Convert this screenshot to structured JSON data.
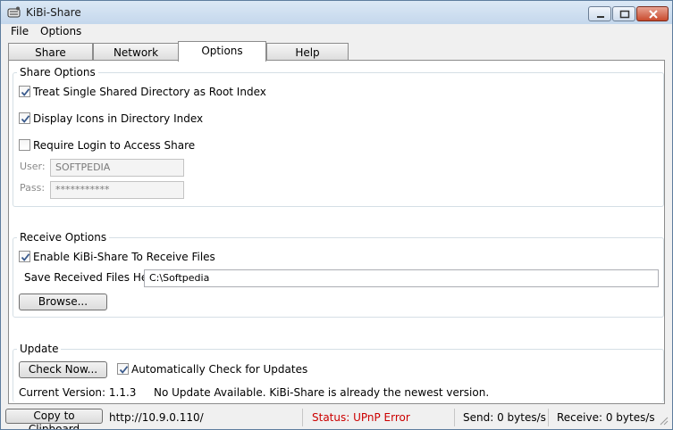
{
  "window": {
    "title": "KiBi-Share"
  },
  "menu": [
    "File",
    "Options"
  ],
  "tabs": [
    {
      "label": "Share"
    },
    {
      "label": "Network"
    },
    {
      "label": "Options"
    },
    {
      "label": "Help"
    }
  ],
  "active_tab": "Options",
  "share_options": {
    "title": "Share Options",
    "treat_root": {
      "label": "Treat Single Shared Directory as Root Index",
      "checked": true
    },
    "display_icons": {
      "label": "Display Icons in Directory Index",
      "checked": true
    },
    "require_login": {
      "label": "Require Login to Access Share",
      "checked": false
    },
    "user_label": "User:",
    "user_value": "SOFTPEDIA",
    "pass_label": "Pass:",
    "pass_value": "***********"
  },
  "receive_options": {
    "title": "Receive Options",
    "enable_receive": {
      "label": "Enable KiBi-Share To Receive Files",
      "checked": true
    },
    "save_label": "Save Received Files Here:",
    "save_path": "C:\\Softpedia",
    "browse_label": "Browse..."
  },
  "update": {
    "title": "Update",
    "check_now_label": "Check Now...",
    "auto_check": {
      "label": "Automatically Check for Updates",
      "checked": true
    },
    "version_text": "Current Version: 1.1.3",
    "status_message": "No Update Available. KiBi-Share is already the newest version."
  },
  "statusbar": {
    "copy_button": "Copy to Clipboard",
    "url": "http://10.9.0.110/",
    "status": "Status: UPnP Error",
    "send": "Send: 0 bytes/s",
    "receive": "Receive: 0 bytes/s"
  },
  "colors": {
    "status_error": "#cc0000"
  }
}
